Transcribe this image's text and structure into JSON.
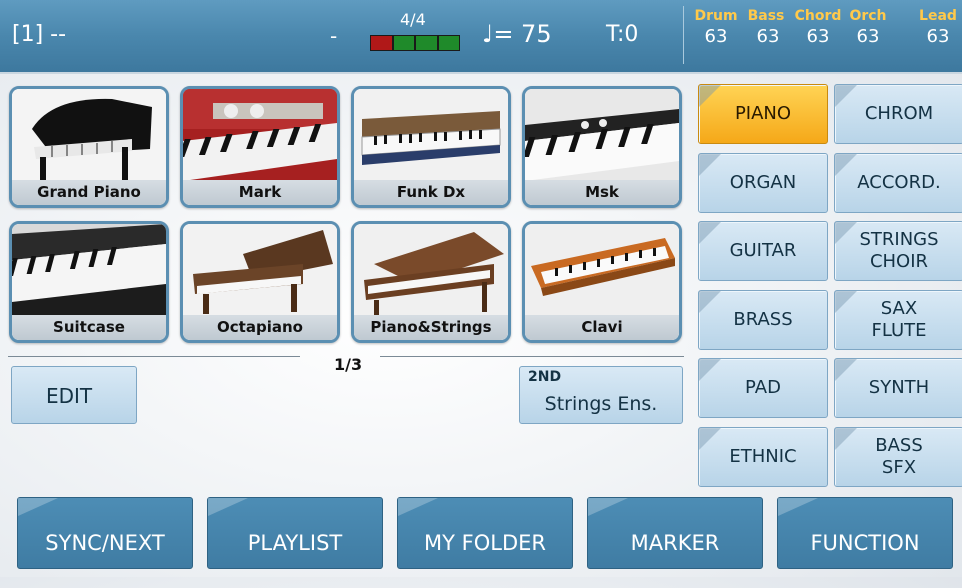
{
  "status": {
    "slot": "[1] --",
    "dash": "-",
    "time_signature": "4/4",
    "tempo": "♩= 75",
    "transpose": "T:0",
    "meter_colors": [
      "#b01818",
      "#1f8a2a",
      "#1f8a2a",
      "#1f8a2a",
      "#1f8a2a"
    ]
  },
  "parts": [
    {
      "name": "Drum",
      "value": "63"
    },
    {
      "name": "Bass",
      "value": "63"
    },
    {
      "name": "Chord",
      "value": "63"
    },
    {
      "name": "Orch",
      "value": "63"
    },
    {
      "name": "Lead",
      "value": "63"
    }
  ],
  "sounds": [
    {
      "label": "Grand Piano"
    },
    {
      "label": "Mark"
    },
    {
      "label": "Funk Dx"
    },
    {
      "label": "Msk"
    },
    {
      "label": "Suitcase"
    },
    {
      "label": "Octapiano"
    },
    {
      "label": "Piano&Strings"
    },
    {
      "label": "Clavi"
    }
  ],
  "page_indicator": "1/3",
  "edit_label": "EDIT",
  "second": {
    "tag": "2ND",
    "value": "Strings Ens."
  },
  "categories": [
    {
      "label": "PIANO",
      "active": true
    },
    {
      "label": "CHROM"
    },
    {
      "label": "ORGAN"
    },
    {
      "label": "ACCORD."
    },
    {
      "label": "GUITAR"
    },
    {
      "label": "STRINGS\nCHOIR"
    },
    {
      "label": "BRASS"
    },
    {
      "label": "SAX\nFLUTE"
    },
    {
      "label": "PAD"
    },
    {
      "label": "SYNTH"
    },
    {
      "label": "ETHNIC"
    },
    {
      "label": "BASS\nSFX"
    }
  ],
  "bottom": [
    "SYNC/NEXT",
    "PLAYLIST",
    "MY FOLDER",
    "MARKER",
    "FUNCTION"
  ],
  "colors": {
    "accent": "#f5a818",
    "bar": "#4a87ad",
    "button": "#b8d4e8"
  }
}
